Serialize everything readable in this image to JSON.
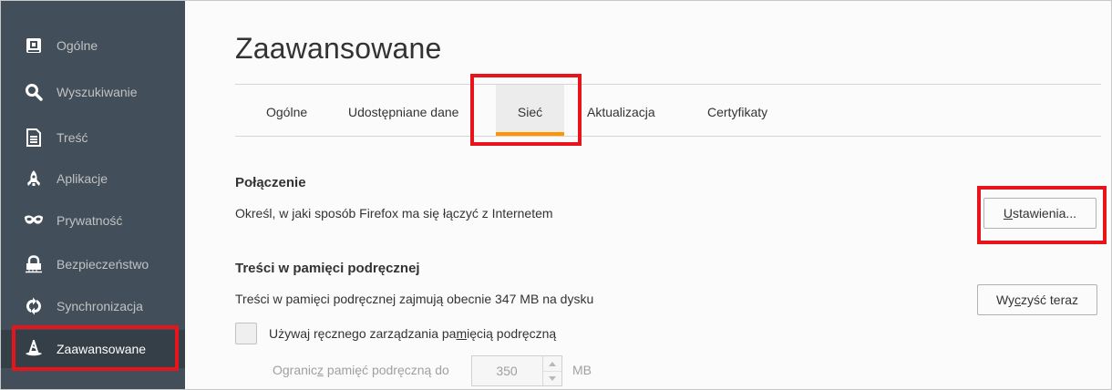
{
  "sidebar": {
    "items": [
      {
        "label": "Ogólne",
        "icon": "general-icon"
      },
      {
        "label": "Wyszukiwanie",
        "icon": "search-icon"
      },
      {
        "label": "Treść",
        "icon": "document-icon"
      },
      {
        "label": "Aplikacje",
        "icon": "rocket-icon"
      },
      {
        "label": "Prywatność",
        "icon": "mask-icon"
      },
      {
        "label": "Bezpieczeństwo",
        "icon": "lock-icon"
      },
      {
        "label": "Synchronizacja",
        "icon": "sync-icon"
      },
      {
        "label": "Zaawansowane",
        "icon": "wizard-hat-icon",
        "active": true
      }
    ]
  },
  "main": {
    "title": "Zaawansowane",
    "tabs": [
      {
        "label": "Ogólne"
      },
      {
        "label": "Udostępniane dane"
      },
      {
        "label": "Sieć",
        "selected": true
      },
      {
        "label": "Aktualizacja"
      },
      {
        "label": "Certyfikaty"
      }
    ],
    "connection": {
      "heading": "Połączenie",
      "description": "Określ, w jaki sposób Firefox ma się łączyć z Internetem",
      "button_pre": "",
      "button_accel": "U",
      "button_post": "stawienia..."
    },
    "cache": {
      "heading": "Treści w pamięci podręcznej",
      "description": "Treści w pamięci podręcznej zajmują obecnie 347 MB na dysku",
      "clear_pre": "Wy",
      "clear_accel": "c",
      "clear_post": "zyść teraz",
      "override_pre": "Używaj ręcznego zarządzania pa",
      "override_accel": "m",
      "override_post": "ięcią podręczną",
      "limit_pre": "Ogranic",
      "limit_accel": "z",
      "limit_post": " pamięć podręczną do",
      "limit_value": "350",
      "limit_unit": "MB"
    }
  },
  "colors": {
    "sidebar_bg": "#424f5a",
    "sidebar_active_bg": "#343f48",
    "tab_underline": "#ff9500",
    "highlight_box": "#e8141b"
  }
}
